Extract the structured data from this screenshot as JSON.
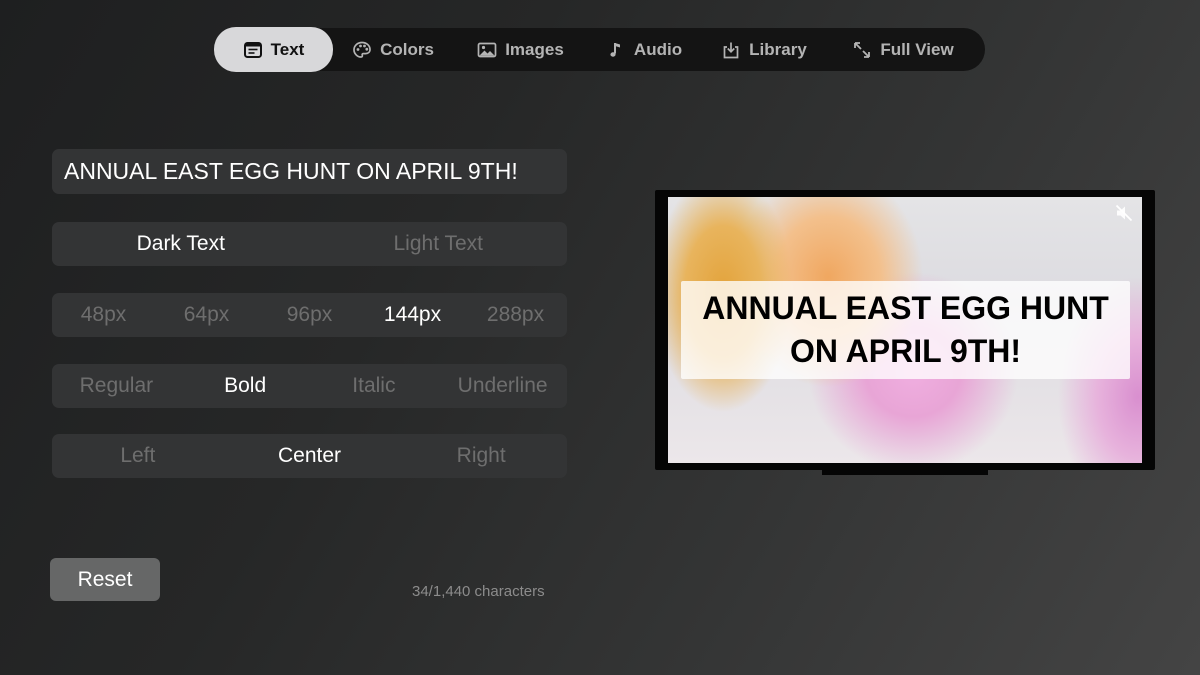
{
  "tabs": [
    {
      "id": "text",
      "label": "Text",
      "icon": "text-document-icon",
      "active": true
    },
    {
      "id": "colors",
      "label": "Colors",
      "icon": "palette-icon",
      "active": false
    },
    {
      "id": "images",
      "label": "Images",
      "icon": "image-icon",
      "active": false
    },
    {
      "id": "audio",
      "label": "Audio",
      "icon": "music-note-icon",
      "active": false
    },
    {
      "id": "library",
      "label": "Library",
      "icon": "download-tray-icon",
      "active": false
    },
    {
      "id": "fullview",
      "label": "Full View",
      "icon": "expand-arrows-icon",
      "active": false
    }
  ],
  "editor": {
    "text_value": "ANNUAL EAST EGG HUNT ON APRIL 9TH!",
    "theme_options": [
      "Dark Text",
      "Light Text"
    ],
    "theme_selected": "Dark Text",
    "size_options": [
      "48px",
      "64px",
      "96px",
      "144px",
      "288px"
    ],
    "size_selected": "144px",
    "style_options": [
      "Regular",
      "Bold",
      "Italic",
      "Underline"
    ],
    "style_selected": "Bold",
    "align_options": [
      "Left",
      "Center",
      "Right"
    ],
    "align_selected": "Center",
    "reset_label": "Reset",
    "char_count": "34/1,440 characters"
  },
  "preview": {
    "caption": "ANNUAL EAST EGG HUNT ON APRIL 9TH!",
    "muted": true
  },
  "colors": {
    "tab_active_bg": "#d8d8da",
    "tab_bar_bg": "#141414",
    "control_bg": "#333435",
    "selected_text": "#ffffff",
    "unselected_text": "#6e6e6e",
    "reset_bg": "#666767"
  }
}
